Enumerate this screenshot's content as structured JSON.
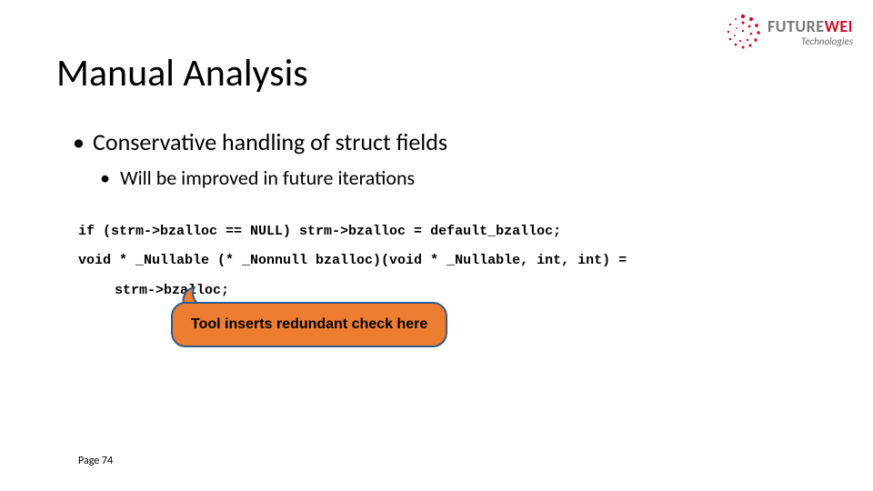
{
  "logo": {
    "part1": "FUTURE",
    "part2": "WEI",
    "sub": "Technologies"
  },
  "title": "Manual Analysis",
  "bullets": {
    "level1": "Conservative handling of struct fields",
    "level2": "Will be improved in future iterations"
  },
  "code": {
    "line1": "if (strm->bzalloc == NULL) strm->bzalloc = default_bzalloc;",
    "line2": "void * _Nullable (* _Nonnull bzalloc)(void * _Nullable, int, int) =",
    "line3": "strm->bzalloc;"
  },
  "callout": "Tool inserts redundant check here",
  "page": "Page 74",
  "colors": {
    "accent": "#c8102e",
    "calloutFill": "#ed7d31",
    "calloutBorder": "#2e5c8a"
  }
}
